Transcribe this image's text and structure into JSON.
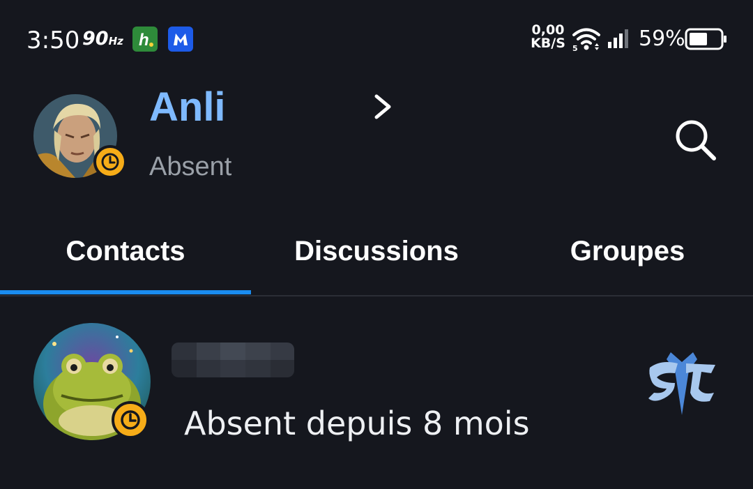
{
  "status_bar": {
    "time": "3:50",
    "refresh_rate": "90",
    "refresh_unit": "Hz",
    "network_speed": "0,00",
    "network_unit": "KB/S",
    "wifi_band": "5",
    "battery_percent": "59%",
    "battery_level": 0.59,
    "app_icons": [
      "h-app-icon",
      "malwarebytes-icon"
    ]
  },
  "header": {
    "user_name": "Anli",
    "user_status": "Absent",
    "status_color": "#f6ac18"
  },
  "tabs": [
    {
      "label": "Contacts",
      "active": true
    },
    {
      "label": "Discussions",
      "active": false
    },
    {
      "label": "Groupes",
      "active": false
    }
  ],
  "contacts": [
    {
      "status": "Absent depuis 8 mois",
      "game_icon": "starcraft-icon"
    }
  ],
  "colors": {
    "background": "#15171e",
    "accent": "#1a8cf0",
    "name": "#7fbaff",
    "away": "#f6ac18"
  }
}
